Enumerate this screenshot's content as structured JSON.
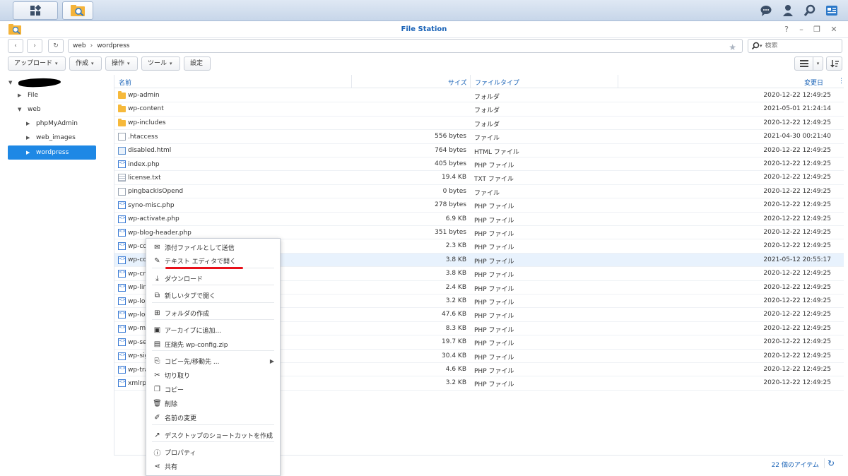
{
  "app": {
    "title": "File Station"
  },
  "address": {
    "crumbs": [
      "web",
      "wordpress"
    ]
  },
  "search": {
    "placeholder": "検索"
  },
  "toolbar": {
    "upload": "アップロード",
    "create": "作成",
    "action": "操作",
    "tools": "ツール",
    "settings": "設定"
  },
  "tree": {
    "items": [
      {
        "label": "File",
        "indent": 1
      },
      {
        "label": "web",
        "indent": 1
      },
      {
        "label": "phpMyAdmin",
        "indent": 2
      },
      {
        "label": "web_images",
        "indent": 2
      },
      {
        "label": "wordpress",
        "indent": 2
      }
    ]
  },
  "columns": {
    "name": "名前",
    "size": "サイズ",
    "type": "ファイルタイプ",
    "modified": "変更日"
  },
  "files": [
    {
      "name": "wp-admin",
      "size": "",
      "type": "フォルダ",
      "modified": "2020-12-22 12:49:25",
      "icon": "folder"
    },
    {
      "name": "wp-content",
      "size": "",
      "type": "フォルダ",
      "modified": "2021-05-01 21:24:14",
      "icon": "folder"
    },
    {
      "name": "wp-includes",
      "size": "",
      "type": "フォルダ",
      "modified": "2020-12-22 12:49:25",
      "icon": "folder"
    },
    {
      "name": ".htaccess",
      "size": "556 bytes",
      "type": "ファイル",
      "modified": "2021-04-30 00:21:40",
      "icon": "file"
    },
    {
      "name": "disabled.html",
      "size": "764 bytes",
      "type": "HTML ファイル",
      "modified": "2020-12-22 12:49:25",
      "icon": "html"
    },
    {
      "name": "index.php",
      "size": "405 bytes",
      "type": "PHP ファイル",
      "modified": "2020-12-22 12:49:25",
      "icon": "php"
    },
    {
      "name": "license.txt",
      "size": "19.4 KB",
      "type": "TXT ファイル",
      "modified": "2020-12-22 12:49:25",
      "icon": "txt"
    },
    {
      "name": "pingbackIsOpend",
      "size": "0 bytes",
      "type": "ファイル",
      "modified": "2020-12-22 12:49:25",
      "icon": "file"
    },
    {
      "name": "syno-misc.php",
      "size": "278 bytes",
      "type": "PHP ファイル",
      "modified": "2020-12-22 12:49:25",
      "icon": "php"
    },
    {
      "name": "wp-activate.php",
      "size": "6.9 KB",
      "type": "PHP ファイル",
      "modified": "2020-12-22 12:49:25",
      "icon": "php"
    },
    {
      "name": "wp-blog-header.php",
      "size": "351 bytes",
      "type": "PHP ファイル",
      "modified": "2020-12-22 12:49:25",
      "icon": "php"
    },
    {
      "name": "wp-cor",
      "size": "2.3 KB",
      "type": "PHP ファイル",
      "modified": "2020-12-22 12:49:25",
      "icon": "php"
    },
    {
      "name": "wp-con",
      "size": "3.8 KB",
      "type": "PHP ファイル",
      "modified": "2021-05-12 20:55:17",
      "icon": "php"
    },
    {
      "name": "wp-cro",
      "size": "3.8 KB",
      "type": "PHP ファイル",
      "modified": "2020-12-22 12:49:25",
      "icon": "php"
    },
    {
      "name": "wp-link",
      "size": "2.4 KB",
      "type": "PHP ファイル",
      "modified": "2020-12-22 12:49:25",
      "icon": "php"
    },
    {
      "name": "wp-loa",
      "size": "3.2 KB",
      "type": "PHP ファイル",
      "modified": "2020-12-22 12:49:25",
      "icon": "php"
    },
    {
      "name": "wp-log",
      "size": "47.6 KB",
      "type": "PHP ファイル",
      "modified": "2020-12-22 12:49:25",
      "icon": "php"
    },
    {
      "name": "wp-ma",
      "size": "8.3 KB",
      "type": "PHP ファイル",
      "modified": "2020-12-22 12:49:25",
      "icon": "php"
    },
    {
      "name": "wp-set",
      "size": "19.7 KB",
      "type": "PHP ファイル",
      "modified": "2020-12-22 12:49:25",
      "icon": "php"
    },
    {
      "name": "wp-sig",
      "size": "30.4 KB",
      "type": "PHP ファイル",
      "modified": "2020-12-22 12:49:25",
      "icon": "php"
    },
    {
      "name": "wp-tra",
      "size": "4.6 KB",
      "type": "PHP ファイル",
      "modified": "2020-12-22 12:49:25",
      "icon": "php"
    },
    {
      "name": "xmlrpc",
      "size": "3.2 KB",
      "type": "PHP ファイル",
      "modified": "2020-12-22 12:49:25",
      "icon": "php"
    }
  ],
  "status": {
    "count": "22 個のアイテム"
  },
  "context_menu": {
    "items": [
      {
        "label": "添付ファイルとして送信",
        "icon": "✉",
        "name": "send-as-attachment"
      },
      {
        "label": "テキスト エディタで開く",
        "icon": "✎",
        "name": "open-in-text-editor"
      },
      {
        "label": "ダウンロード",
        "icon": "⤓",
        "name": "download"
      },
      {
        "label": "新しいタブで開く",
        "icon": "⧉",
        "name": "open-new-tab"
      },
      {
        "label": "フォルダの作成",
        "icon": "⊞",
        "name": "create-folder"
      },
      {
        "label": "アーカイブに追加...",
        "icon": "▣",
        "name": "add-to-archive"
      },
      {
        "label": "圧縮先 wp-config.zip",
        "icon": "▤",
        "name": "compress-to-zip"
      },
      {
        "label": "コピー先/移動先 ...",
        "icon": "⎘",
        "name": "copy-move-to",
        "submenu": true
      },
      {
        "label": "切り取り",
        "icon": "✂",
        "name": "cut"
      },
      {
        "label": "コピー",
        "icon": "❐",
        "name": "copy"
      },
      {
        "label": "削除",
        "icon": "🗑",
        "name": "delete"
      },
      {
        "label": "名前の変更",
        "icon": "✐",
        "name": "rename"
      },
      {
        "label": "デスクトップのショートカットを作成",
        "icon": "↗",
        "name": "create-desktop-shortcut"
      },
      {
        "label": "プロパティ",
        "icon": "ⓘ",
        "name": "properties"
      },
      {
        "label": "共有",
        "icon": "⋖",
        "name": "share"
      }
    ]
  }
}
